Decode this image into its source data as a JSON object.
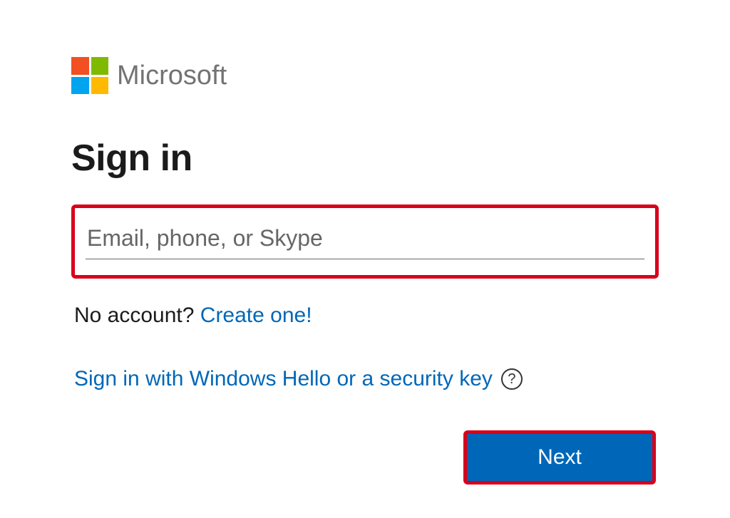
{
  "brand": {
    "name": "Microsoft"
  },
  "heading": "Sign in",
  "input": {
    "placeholder": "Email, phone, or Skype",
    "value": ""
  },
  "no_account": {
    "prefix": "No account? ",
    "link": "Create one!"
  },
  "alt_signin": {
    "label": "Sign in with Windows Hello or a security key",
    "help_glyph": "?"
  },
  "buttons": {
    "next": "Next"
  }
}
